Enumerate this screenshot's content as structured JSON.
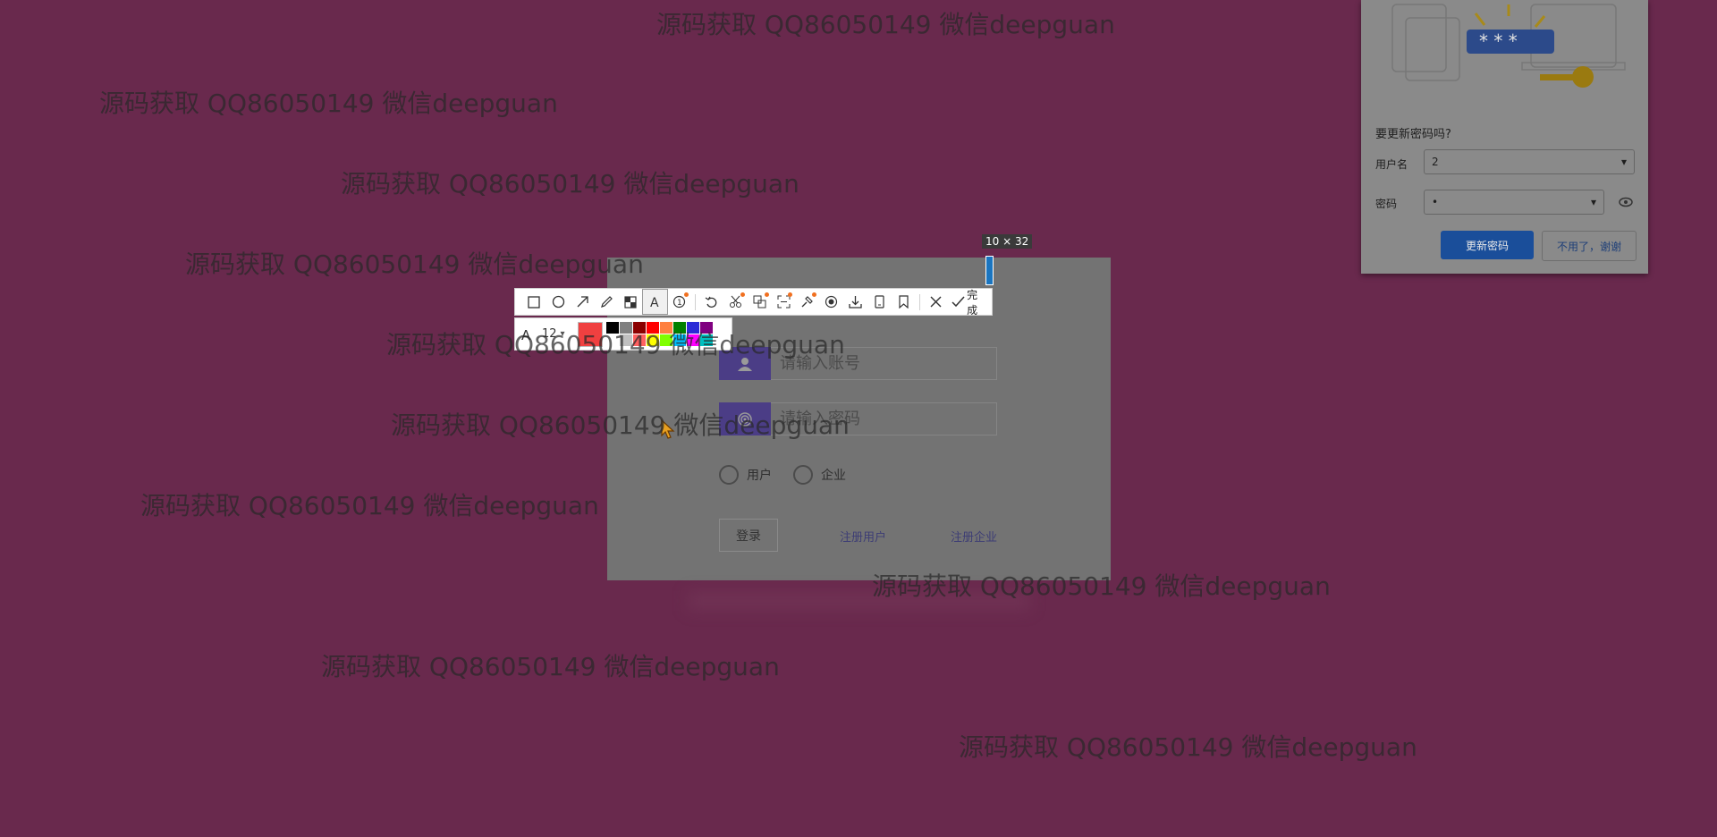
{
  "watermark_text": "源码获取 QQ86050149 微信deepguan",
  "login": {
    "account_placeholder": "请输入账号",
    "password_placeholder": "请输入密码",
    "radio_user": "用户",
    "radio_company": "企业",
    "login_button": "登录",
    "register_user": "注册用户",
    "register_company": "注册企业"
  },
  "capture_tool": {
    "dimension": "10 × 32",
    "done_label": "完成",
    "font_size": "12",
    "tools": [
      "rectangle-icon",
      "ellipse-icon",
      "arrow-icon",
      "pencil-icon",
      "mosaic-icon",
      "text-icon",
      "numbered-marker-icon",
      "undo-icon",
      "cut-icon",
      "translate-icon",
      "ocr-icon",
      "pin-icon",
      "record-icon",
      "download-icon",
      "device-icon",
      "bookmark-icon",
      "close-icon",
      "check-icon"
    ],
    "current_color": "#f04040",
    "palette": [
      "#000000",
      "#808080",
      "#8b0000",
      "#ff0000",
      "#ff8040",
      "#008000",
      "#2b2bd6",
      "#800080",
      "#ffffff",
      "#c0c0c0",
      "#ff6060",
      "#ffff00",
      "#80ff00",
      "#00c0ff",
      "#ff00ff",
      "#00c0c0"
    ]
  },
  "password_prompt": {
    "title": "要更新密码吗?",
    "username_label": "用户名",
    "username_value": "2",
    "password_label": "密码",
    "password_value": "•",
    "update_button": "更新密码",
    "dismiss_button": "不用了，谢谢"
  }
}
